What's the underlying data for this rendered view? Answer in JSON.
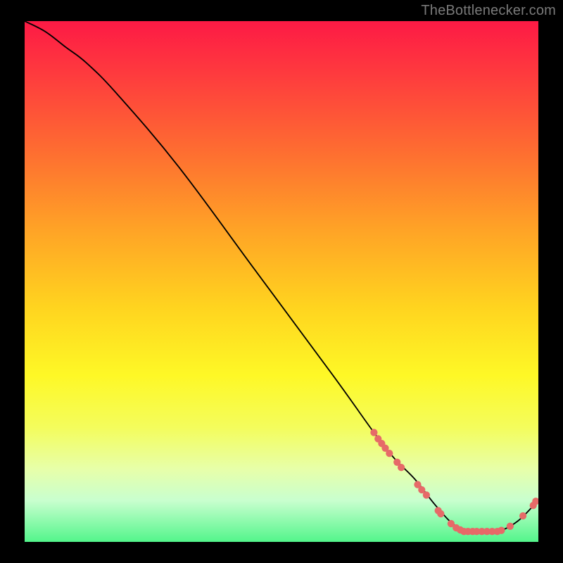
{
  "attribution": "TheBottlenecker.com",
  "chart_data": {
    "type": "line",
    "title": "",
    "xlabel": "",
    "ylabel": "",
    "xlim": [
      0,
      100
    ],
    "ylim": [
      0,
      100
    ],
    "series": [
      {
        "name": "curve",
        "x": [
          0,
          4,
          8,
          12,
          18,
          30,
          45,
          60,
          68,
          72,
          76,
          80,
          84,
          88,
          92,
          96,
          100
        ],
        "y": [
          100,
          98,
          95,
          92,
          86,
          72,
          52,
          32,
          21,
          16,
          12,
          7,
          3,
          2,
          2,
          4,
          8
        ]
      }
    ],
    "marker_points": [
      {
        "x": 68.0,
        "y": 21.0
      },
      {
        "x": 68.8,
        "y": 19.8
      },
      {
        "x": 69.5,
        "y": 18.9
      },
      {
        "x": 70.2,
        "y": 18.0
      },
      {
        "x": 71.0,
        "y": 17.0
      },
      {
        "x": 72.5,
        "y": 15.3
      },
      {
        "x": 73.3,
        "y": 14.3
      },
      {
        "x": 76.5,
        "y": 11.0
      },
      {
        "x": 77.3,
        "y": 10.0
      },
      {
        "x": 78.2,
        "y": 9.0
      },
      {
        "x": 80.5,
        "y": 6.0
      },
      {
        "x": 81.0,
        "y": 5.4
      },
      {
        "x": 83.0,
        "y": 3.5
      },
      {
        "x": 84.0,
        "y": 2.7
      },
      {
        "x": 84.8,
        "y": 2.3
      },
      {
        "x": 85.5,
        "y": 2.0
      },
      {
        "x": 86.3,
        "y": 2.0
      },
      {
        "x": 87.2,
        "y": 2.0
      },
      {
        "x": 88.0,
        "y": 2.0
      },
      {
        "x": 89.0,
        "y": 2.0
      },
      {
        "x": 90.0,
        "y": 2.0
      },
      {
        "x": 91.0,
        "y": 2.0
      },
      {
        "x": 92.0,
        "y": 2.0
      },
      {
        "x": 92.8,
        "y": 2.2
      },
      {
        "x": 94.5,
        "y": 3.0
      },
      {
        "x": 97.0,
        "y": 5.0
      },
      {
        "x": 99.0,
        "y": 7.0
      },
      {
        "x": 99.5,
        "y": 7.8
      }
    ],
    "gradient_stops": [
      {
        "pos": 0,
        "color": "#fd1a45"
      },
      {
        "pos": 25,
        "color": "#fe6d31"
      },
      {
        "pos": 55,
        "color": "#ffd41f"
      },
      {
        "pos": 78,
        "color": "#f4fd5c"
      },
      {
        "pos": 100,
        "color": "#53f58b"
      }
    ]
  }
}
